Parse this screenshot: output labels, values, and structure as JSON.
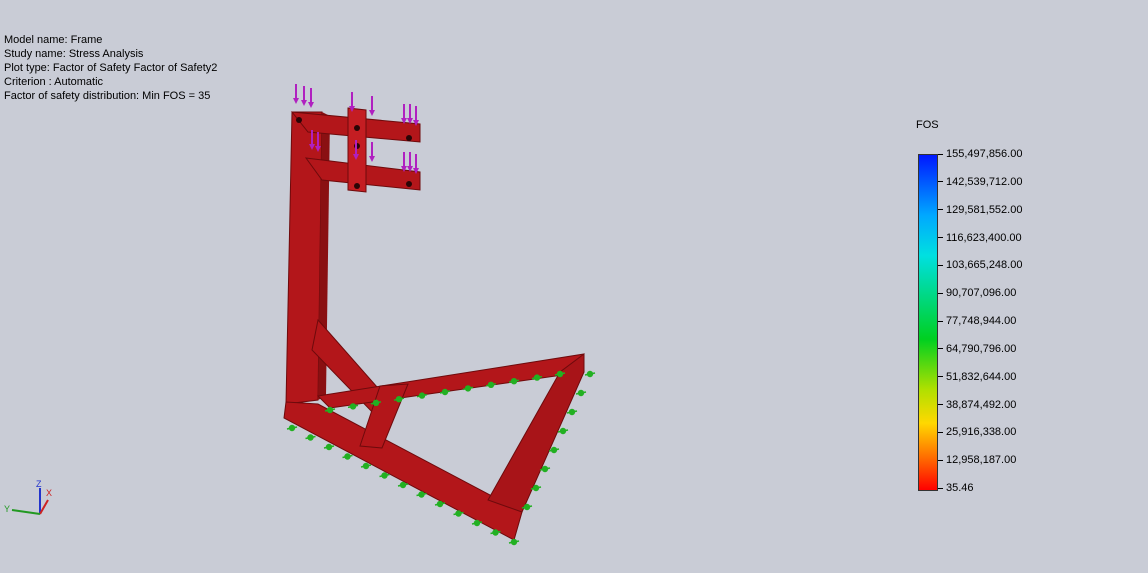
{
  "study_info": {
    "model_name": "Model name: Frame",
    "study_name": "Study name: Stress Analysis",
    "plot_type": "Plot type: Factor of Safety Factor of Safety2",
    "criterion": "Criterion : Automatic",
    "distribution": "Factor of safety distribution: Min FOS = 35"
  },
  "legend": {
    "title": "FOS",
    "ticks": [
      "155,497,856.00",
      "142,539,712.00",
      "129,581,552.00",
      "116,623,400.00",
      "103,665,248.00",
      "90,707,096.00",
      "77,748,944.00",
      "64,790,796.00",
      "51,832,644.00",
      "38,874,492.00",
      "25,916,338.00",
      "12,958,187.00",
      "35.46"
    ],
    "colors": {
      "max": "#0018ff",
      "blue_cyan": "#00a8ff",
      "cyan": "#00e0e0",
      "green": "#00d020",
      "yellow_green": "#b0e000",
      "yellow": "#ffd800",
      "orange": "#ff7000",
      "min": "#ff0000"
    }
  },
  "model": {
    "color": "#b3161a",
    "highlight": "#d42828",
    "load_arrow_color": "#b020c0",
    "fixture_color": "#22b022"
  },
  "triad": {
    "z_label": "Z",
    "x_label": "X",
    "y_label": "Y"
  }
}
